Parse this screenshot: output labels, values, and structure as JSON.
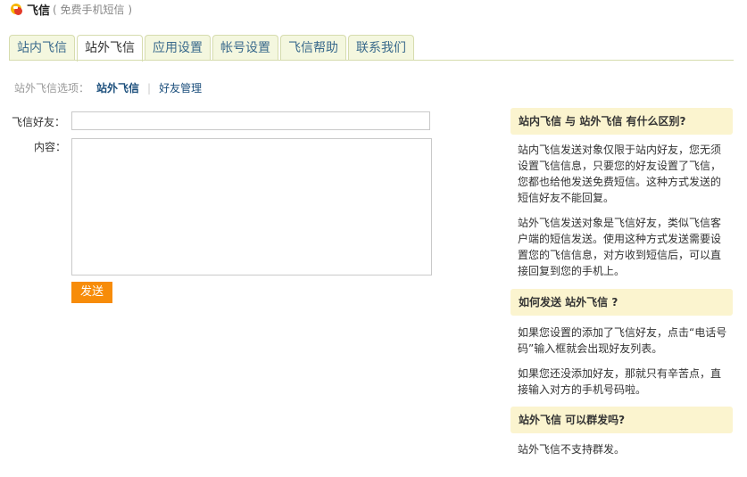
{
  "header": {
    "title": "飞信",
    "subtitle": "( 免费手机短信 )"
  },
  "tabs": [
    {
      "label": "站内飞信",
      "active": false
    },
    {
      "label": "站外飞信",
      "active": true
    },
    {
      "label": "应用设置",
      "active": false
    },
    {
      "label": "帐号设置",
      "active": false
    },
    {
      "label": "飞信帮助",
      "active": false
    },
    {
      "label": "联系我们",
      "active": false
    }
  ],
  "subnav": {
    "label": "站外飞信选项：",
    "current": "站外飞信",
    "link": "好友管理"
  },
  "form": {
    "friend_label": "飞信好友：",
    "friend_value": "",
    "content_label": "内容：",
    "content_value": "",
    "send_label": "发送"
  },
  "faq": [
    {
      "question": "站内飞信  与  站外飞信  有什么区别?",
      "answers": [
        "站内飞信发送对象仅限于站内好友，您无须设置飞信信息，只要您的好友设置了飞信，您都也给他发送免费短信。这种方式发送的短信好友不能回复。",
        "站外飞信发送对象是飞信好友，类似飞信客户端的短信发送。使用这种方式发送需要设置您的飞信信息，对方收到短信后，可以直接回复到您的手机上。"
      ]
    },
    {
      "question": "如何发送  站外飞信  ?",
      "answers": [
        "如果您设置的添加了飞信好友，点击“电话号码”输入框就会出现好友列表。",
        "如果您还没添加好友，那就只有辛苦点，直接输入对方的手机号码啦。"
      ]
    },
    {
      "question": "站外飞信  可以群发吗?",
      "answers": [
        "站外飞信不支持群发。"
      ]
    }
  ],
  "colors": {
    "tab_bg": "#f4f7df",
    "tab_border": "#d6dcae",
    "link": "#1c4f7c",
    "button": "#f78c09",
    "faq_head_bg": "#fbf4cf"
  }
}
